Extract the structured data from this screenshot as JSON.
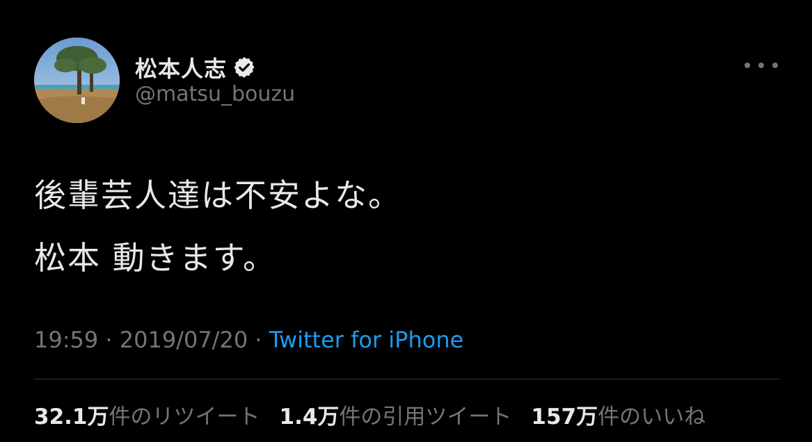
{
  "author": {
    "display_name": "松本人志",
    "handle": "@matsu_bouzu",
    "verified": true
  },
  "tweet": {
    "lines": [
      "後輩芸人達は不安よな。",
      "松本 動きます。"
    ]
  },
  "meta": {
    "time": "19:59",
    "separator1": " · ",
    "date": "2019/07/20",
    "separator2": " · ",
    "source": "Twitter for iPhone"
  },
  "stats": [
    {
      "count": "32.1万",
      "label": "件のリツイート"
    },
    {
      "count": "1.4万",
      "label": "件の引用ツイート"
    },
    {
      "count": "157万",
      "label": "件のいいね"
    }
  ],
  "colors": {
    "background": "#000000",
    "primary_text": "#e7e9ea",
    "secondary_text": "#71767b",
    "link": "#1d9bf0",
    "divider": "#2f3336"
  },
  "icons": {
    "verified": "verified-badge-icon",
    "more": "more-options-icon"
  }
}
